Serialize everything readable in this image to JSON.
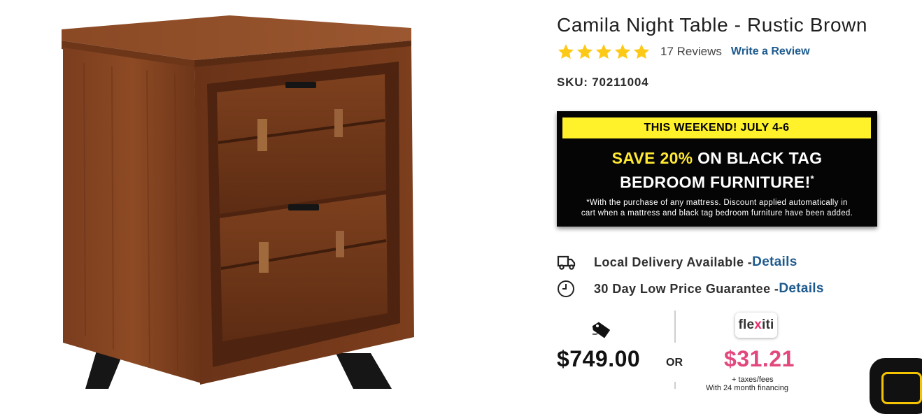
{
  "product": {
    "title": "Camila Night Table - Rustic Brown",
    "rating_stars": 5,
    "reviews_label": "17 Reviews",
    "write_review_label": "Write a Review",
    "sku_label": "SKU: 70211004"
  },
  "promo": {
    "band": "THIS WEEKEND! JULY 4-6",
    "headline_highlight": "SAVE 20%",
    "headline_rest": " ON BLACK TAG",
    "headline_line2": "BEDROOM FURNITURE!",
    "headline_mark": "*",
    "fine_line1": "*With the purchase of any mattress. Discount applied automatically in",
    "fine_line2": "cart when a mattress and black tag bedroom furniture have been added."
  },
  "info": {
    "delivery_text": "Local Delivery Available - ",
    "delivery_link": "Details",
    "guarantee_text": "30 Day Low Price Guarantee - ",
    "guarantee_link": "Details"
  },
  "pricing": {
    "price": "$749.00",
    "or_label": "OR",
    "financing_logo_a": "fle",
    "financing_logo_x": "x",
    "financing_logo_b": "iti",
    "monthly_price": "$31.21",
    "fees_label": "+ taxes/fees",
    "financing_label": "With 24 month financing"
  },
  "colors": {
    "link": "#1c5a8e",
    "star": "#fdc918",
    "promo_band": "#fff22b",
    "monthly_price": "#e2477e"
  },
  "icons": {
    "delivery": "truck-icon",
    "guarantee": "clock-icon",
    "price_tag": "price-tag-icon",
    "chat": "chat-icon"
  }
}
